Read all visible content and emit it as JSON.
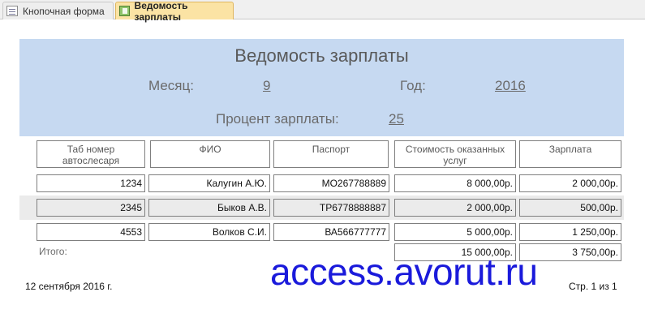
{
  "tabs": [
    {
      "label": "Кнопочная форма",
      "icon": "form-icon"
    },
    {
      "label": "Ведомость зарплаты",
      "icon": "report-icon"
    }
  ],
  "report": {
    "title": "Ведомость зарплаты",
    "month_label": "Месяц:",
    "month_value": "9",
    "year_label": "Год:",
    "year_value": "2016",
    "percent_label": "Процент зарплаты:",
    "percent_value": "25",
    "columns": [
      "Таб номер автослесаря",
      "ФИО",
      "Паспорт",
      "Стоимость оказанных услуг",
      "Зарплата"
    ],
    "rows": [
      {
        "tab": "1234",
        "fio": "Калугин А.Ю.",
        "passport": "МО267788889",
        "cost": "8 000,00р.",
        "salary": "2 000,00р."
      },
      {
        "tab": "2345",
        "fio": "Быков А.В.",
        "passport": "ТР6778888887",
        "cost": "2 000,00р.",
        "salary": "500,00р."
      },
      {
        "tab": "4553",
        "fio": "Волков С.И.",
        "passport": "ВА566777777",
        "cost": "5 000,00р.",
        "salary": "1 250,00р."
      }
    ],
    "total_label": "Итого:",
    "total_cost": "15 000,00р.",
    "total_salary": "3 750,00р."
  },
  "footer": {
    "date": "12 сентября 2016 г.",
    "page": "Стр. 1 из 1"
  },
  "watermark": "access.avorut.ru",
  "colors": {
    "header_bg": "#c6d9f1",
    "active_tab": "#fbe3a4",
    "watermark": "#1a1adb"
  }
}
